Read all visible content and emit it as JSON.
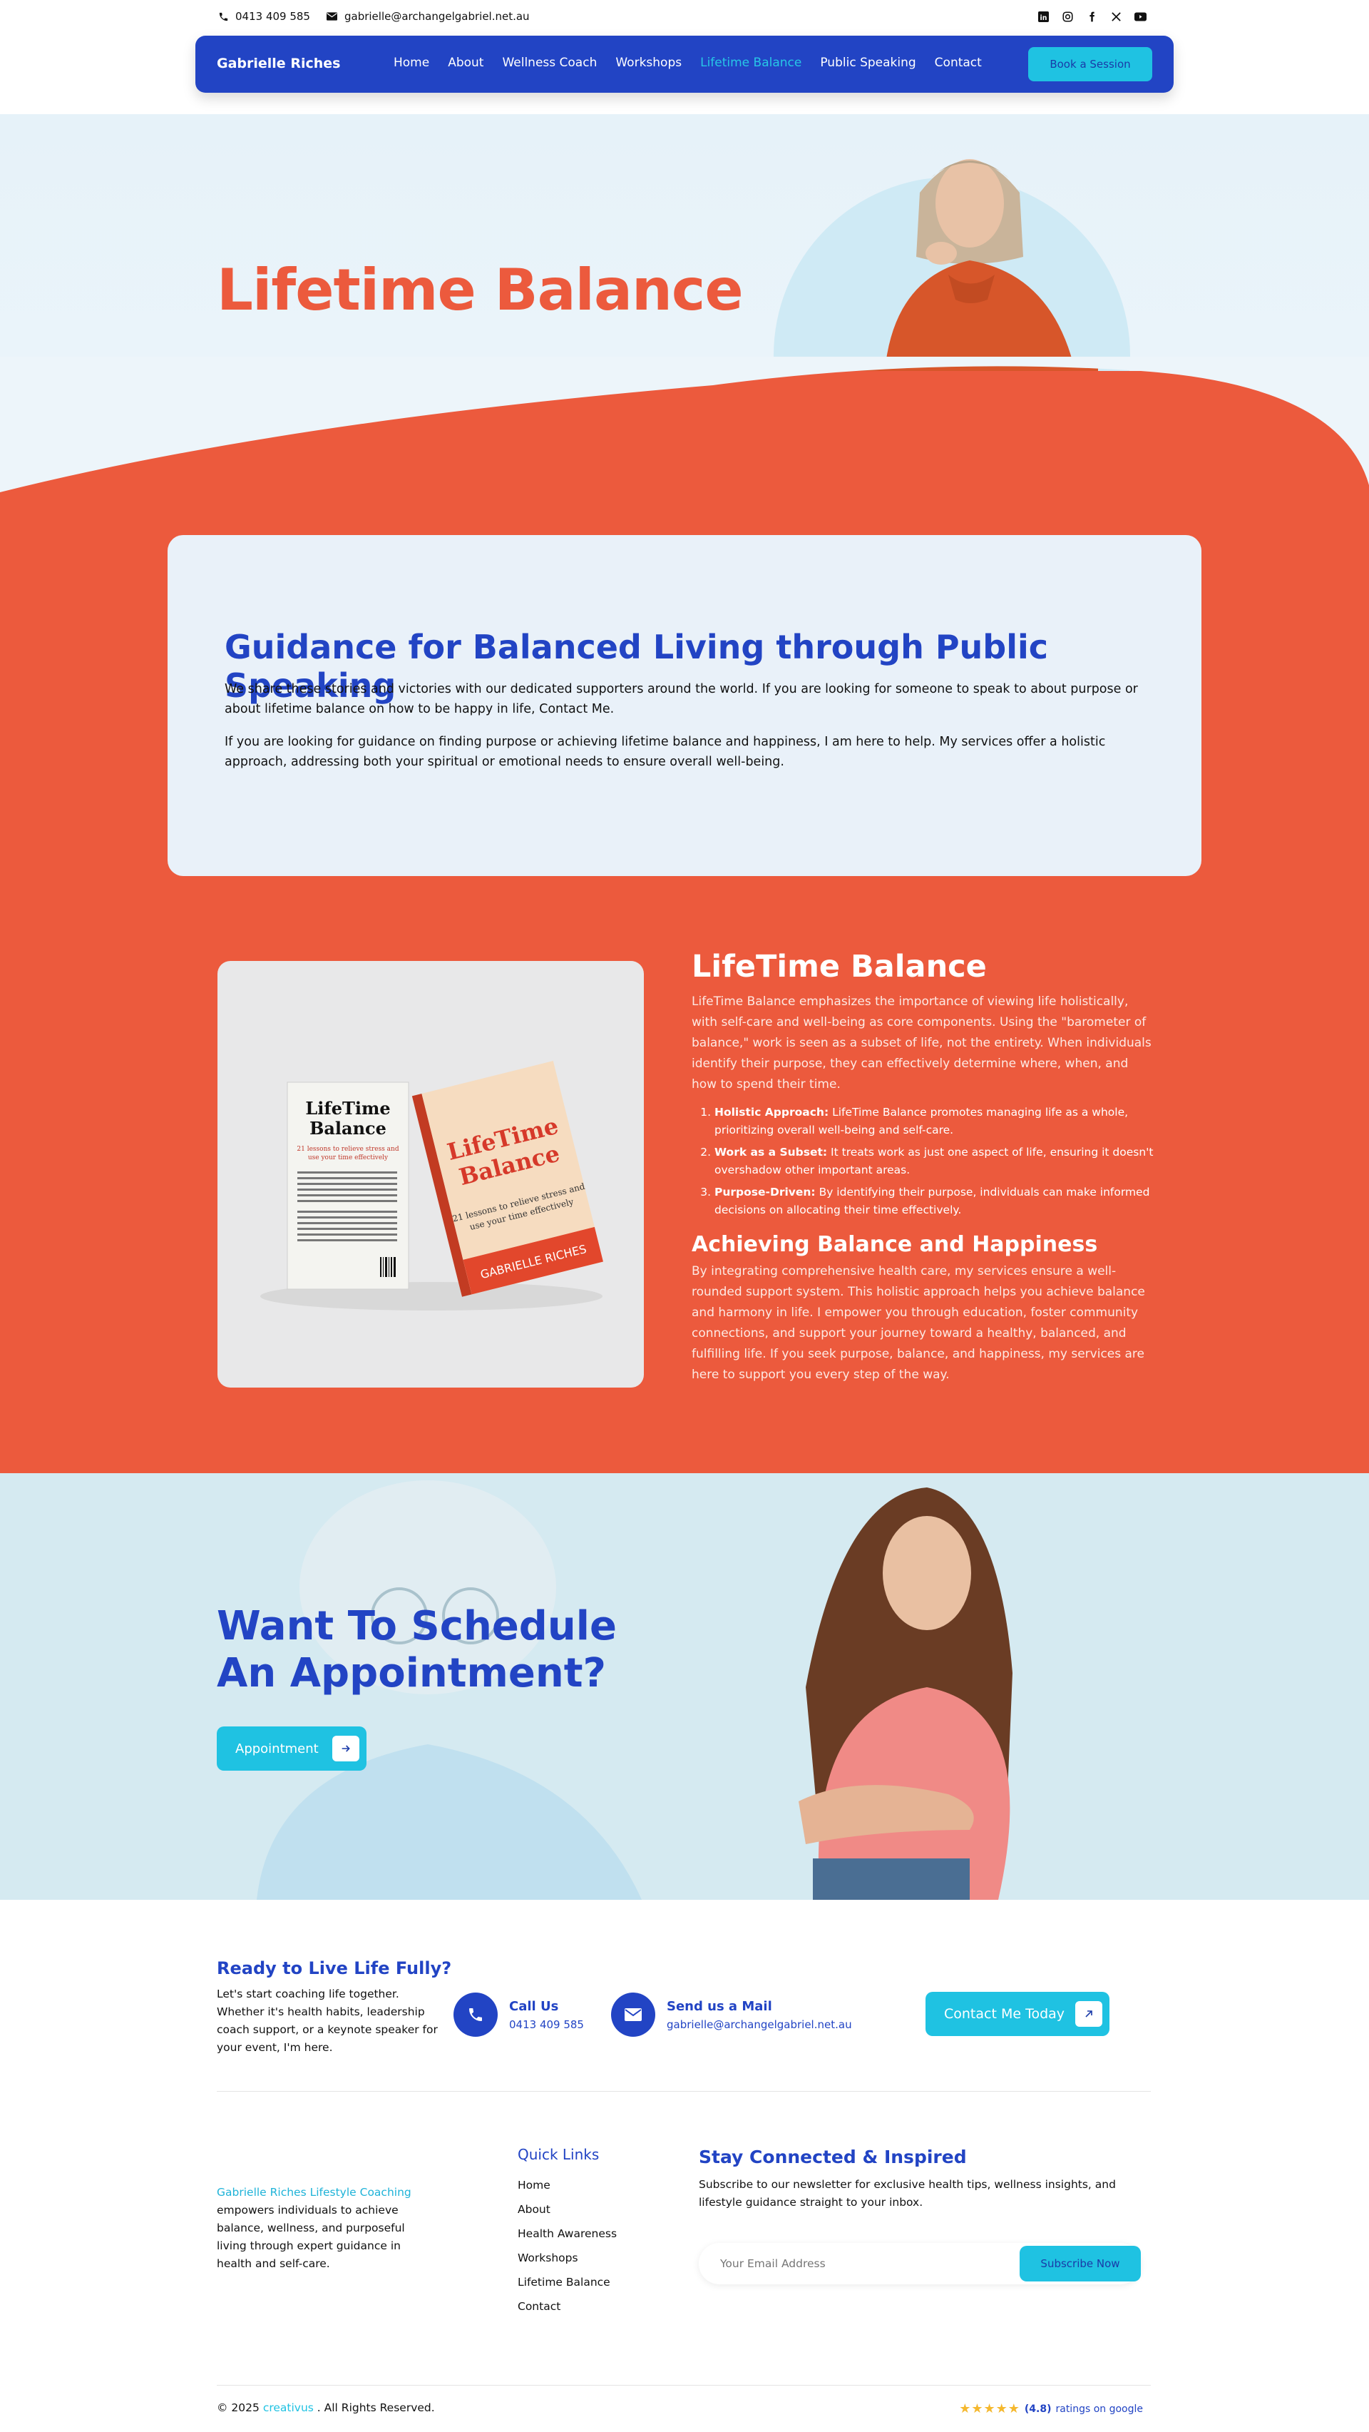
{
  "topbar": {
    "phone": "0413 409 585",
    "email": "gabrielle@archangelgabriel.net.au",
    "social_icons": [
      "linkedin-icon",
      "instagram-icon",
      "facebook-icon",
      "x-icon",
      "youtube-icon"
    ]
  },
  "nav": {
    "brand": "Gabrielle Riches",
    "items": [
      "Home",
      "About",
      "Wellness Coach",
      "Workshops",
      "Lifetime Balance",
      "Public Speaking",
      "Contact"
    ],
    "active": "Lifetime Balance",
    "cta": "Book a Session"
  },
  "hero": {
    "title": "Lifetime Balance"
  },
  "guidance": {
    "title": "Guidance for Balanced Living through Public Speaking",
    "p1": "We share these stories and victories with our dedicated supporters around the world. If you are looking for someone to speak to about purpose or about lifetime balance on how to be happy in life, Contact Me.",
    "p2": "If you are looking for guidance on finding purpose or achieving lifetime balance and happiness, I am here to help. My services offer a holistic approach, addressing both your spiritual or emotional needs to ensure overall well-being."
  },
  "book": {
    "back_title": "LifeTime Balance",
    "back_sub": "21 lessons to relieve stress and use your time effectively",
    "front_title": "LifeTime Balance",
    "front_sub": "21 lessons to relieve stress and use your time effectively",
    "author": "GABRIELLE RICHES"
  },
  "lifetime": {
    "title": "LifeTime Balance",
    "intro": "LifeTime Balance emphasizes the importance of viewing life holistically, with self-care and well-being as core components. Using the \"barometer of balance,\" work is seen as a subset of life, not the entirety. When individuals identify their purpose, they can effectively determine where, when, and how to spend their time.",
    "points": [
      {
        "label": "Holistic Approach:",
        "text": " LifeTime Balance promotes managing life as a whole, prioritizing overall well-being and self-care."
      },
      {
        "label": "Work as a Subset:",
        "text": " It treats work as just one aspect of life, ensuring it doesn't overshadow other important areas."
      },
      {
        "label": "Purpose-Driven:",
        "text": " By identifying their purpose, individuals can make informed decisions on allocating their time effectively."
      }
    ],
    "subtitle": "Achieving Balance and Happiness",
    "outro": "By integrating comprehensive health care, my services ensure a well-rounded support system. This holistic approach helps you achieve balance and harmony in life. I empower you through education, foster community connections, and support your journey toward a healthy, balanced, and fulfilling life. If you seek purpose, balance, and happiness, my services are here to support you every step of the way."
  },
  "appointment": {
    "title": "Want To Schedule An Appointment?",
    "button": "Appointment"
  },
  "contact": {
    "title": "Ready to Live Life Fully?",
    "intro": "Let's start coaching life together. Whether it's health habits, leadership coach support, or a keynote speaker for your event, I'm here.",
    "call_label": "Call Us",
    "call_value": "0413 409 585",
    "mail_label": "Send us a Mail",
    "mail_value": "gabrielle@archangelgabriel.net.au",
    "cta": "Contact Me Today"
  },
  "footer": {
    "brand_link": "Gabrielle Riches Lifestyle Coaching",
    "brand_text": "empowers individuals to achieve balance, wellness, and purposeful living through expert guidance in health and self-care.",
    "quick_title": "Quick Links",
    "quick_links": [
      "Home",
      "About",
      "Health Awareness",
      "Workshops",
      "Lifetime Balance",
      "Contact"
    ],
    "news_title": "Stay Connected & Inspired",
    "news_text": "Subscribe to our newsletter for exclusive health tips, wellness insights, and lifestyle guidance straight to your inbox.",
    "email_placeholder": "Your Email Address",
    "subscribe": "Subscribe Now",
    "copy_pre": "© 2025",
    "copy_brand": "creativus",
    "copy_post": ". All Rights Reserved.",
    "stars": "★★★★★",
    "rating": "(4.8)",
    "rating_text": "ratings on google"
  },
  "colors": {
    "primary": "#2244c4",
    "accent": "#1fc2e2",
    "coral": "#ec5a3d"
  }
}
